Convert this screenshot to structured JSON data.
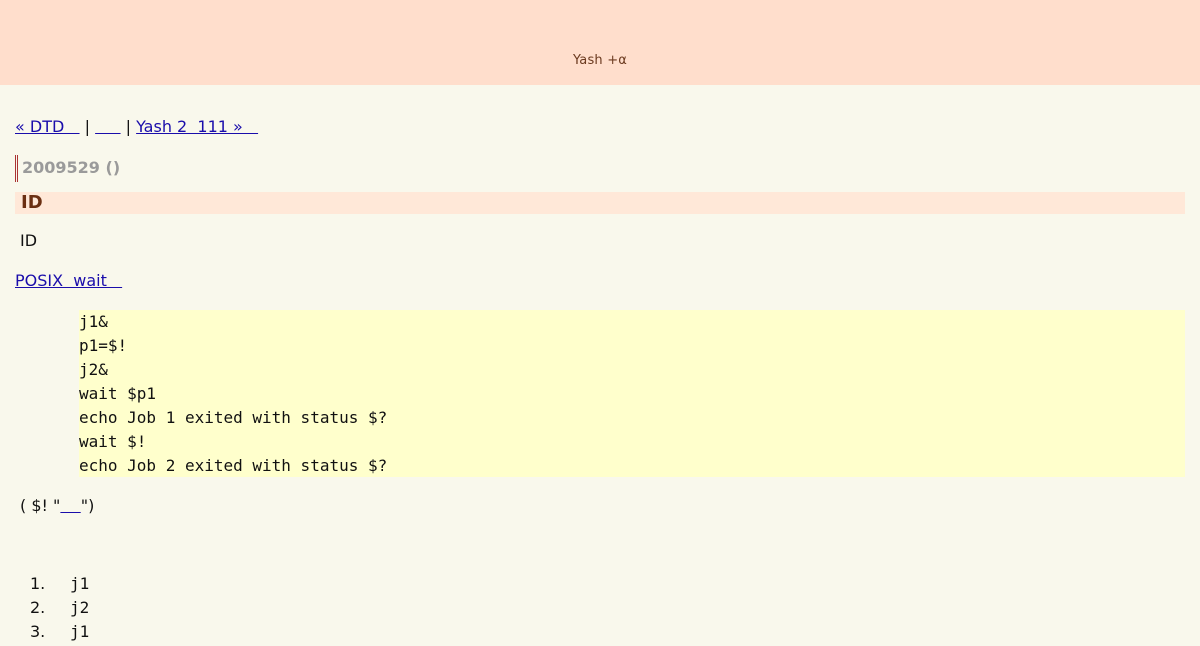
{
  "header": {
    "title": "Yash  +α"
  },
  "nav": {
    "prev": "« DTD   ",
    "separator1": " | ",
    "middle": "     ",
    "separator2": " | ",
    "next": "Yash 2  111 »   "
  },
  "post": {
    "date": "2009529 ()",
    "heading": "ID",
    "paragraph1": "ID",
    "link_text": "POSIX  wait   ",
    "code_lines": [
      "j1&",
      "p1=$!",
      "j2&",
      "wait $p1",
      "echo Job 1 exited with status $?",
      "wait $!",
      "echo Job 2 exited with status $?"
    ],
    "note_before": "( $! \"",
    "note_link": "    ",
    "note_after": "\")",
    "list": [
      {
        "num": "1.",
        "text": "j1"
      },
      {
        "num": "2.",
        "text": "j2"
      },
      {
        "num": "3.",
        "text": "j1"
      }
    ]
  }
}
